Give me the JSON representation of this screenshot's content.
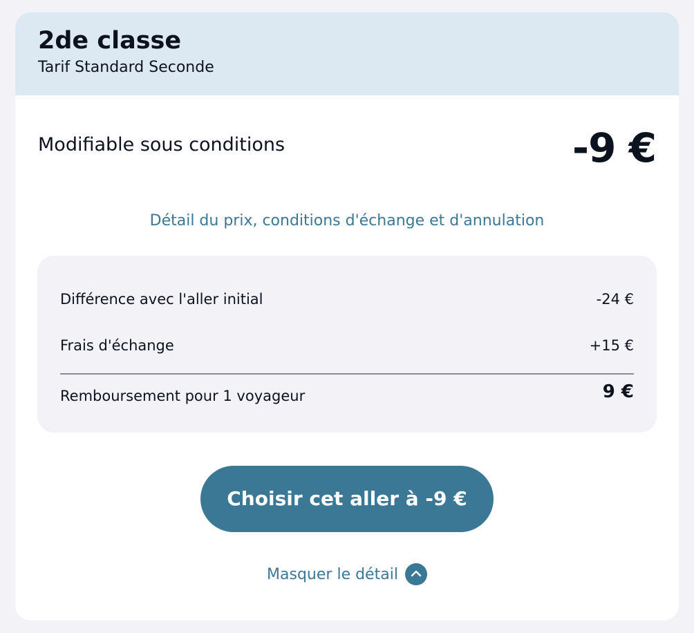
{
  "header": {
    "class_title": "2de classe",
    "tariff": "Tarif Standard Seconde",
    "background_color": "#dde9f2"
  },
  "offer": {
    "condition": "Modifiable sous conditions",
    "price": "-9 €"
  },
  "detail_link": "Détail du prix, conditions d'échange et d'annulation",
  "breakdown": {
    "lines": [
      {
        "label": "Différence avec l'aller initial",
        "amount": "-24 €"
      },
      {
        "label": "Frais d'échange",
        "amount": "+15 €"
      }
    ],
    "total": {
      "label": "Remboursement pour 1 voyageur",
      "amount": "9 €"
    }
  },
  "cta": {
    "label": "Choisir cet aller à -9 €",
    "color": "#3a7896"
  },
  "toggle": {
    "label": "Masquer le détail",
    "icon": "chevron-up-icon"
  }
}
